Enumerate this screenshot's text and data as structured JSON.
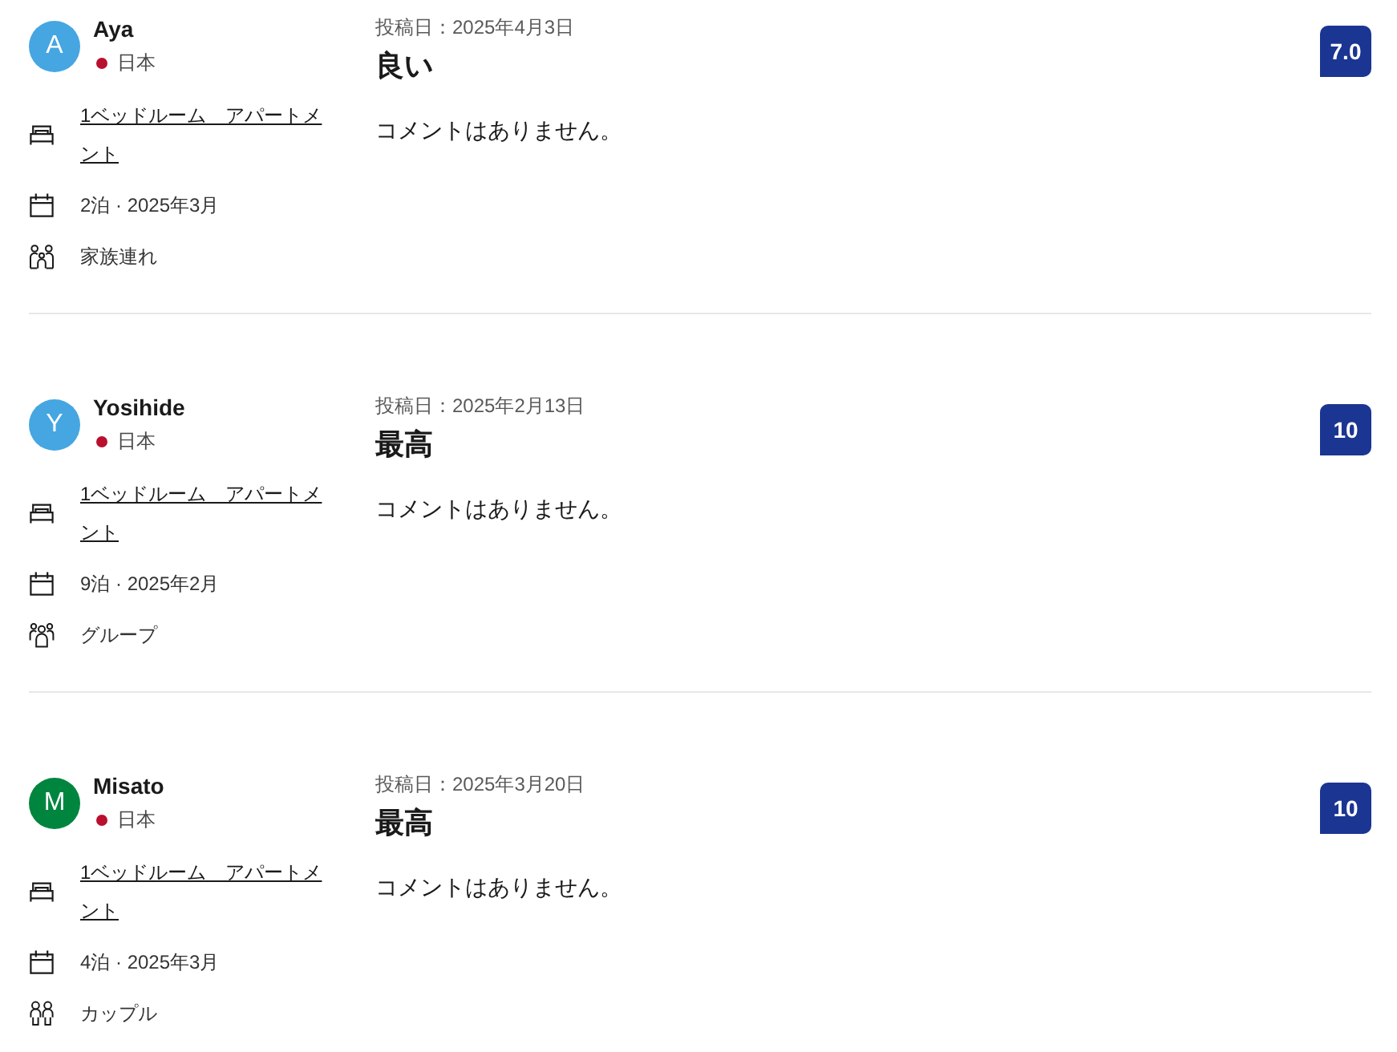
{
  "reviews": [
    {
      "reviewer": {
        "initial": "A",
        "name": "Aya",
        "color": "#45a6e2",
        "country": "日本"
      },
      "room": "1ベッドルーム　アパートメント",
      "stay": "2泊 · 2025年3月",
      "traveler": {
        "kind": "family",
        "label": "家族連れ"
      },
      "posted": "投稿日：2025年4月3日",
      "headline": "良い",
      "comment": "コメントはありません。",
      "score": "7.0"
    },
    {
      "reviewer": {
        "initial": "Y",
        "name": "Yosihide",
        "color": "#45a6e2",
        "country": "日本"
      },
      "room": "1ベッドルーム　アパートメント",
      "stay": "9泊 · 2025年2月",
      "traveler": {
        "kind": "group",
        "label": "グループ"
      },
      "posted": "投稿日：2025年2月13日",
      "headline": "最高",
      "comment": "コメントはありません。",
      "score": "10"
    },
    {
      "reviewer": {
        "initial": "M",
        "name": "Misato",
        "color": "#00853e",
        "country": "日本"
      },
      "room": "1ベッドルーム　アパートメント",
      "stay": "4泊 · 2025年3月",
      "traveler": {
        "kind": "couple",
        "label": "カップル"
      },
      "posted": "投稿日：2025年3月20日",
      "headline": "最高",
      "comment": "コメントはありません。",
      "score": "10"
    }
  ]
}
